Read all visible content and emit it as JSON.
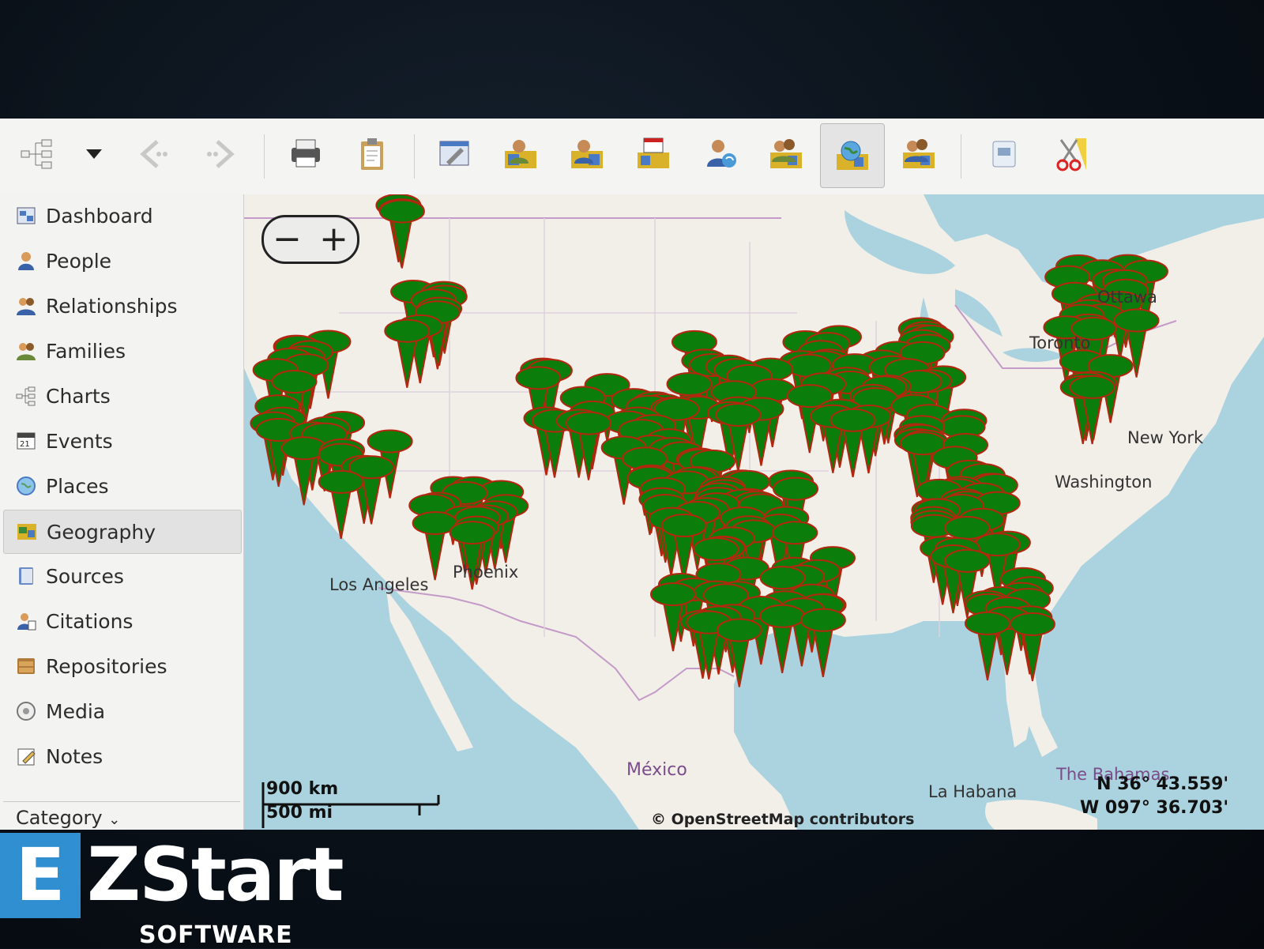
{
  "toolbar": {
    "buttons": [
      {
        "icon": "tree-chart-icon"
      },
      {
        "icon": "dropdown-arrow-icon"
      },
      {
        "icon": "back-arrow-icon"
      },
      {
        "icon": "forward-arrow-icon"
      },
      {
        "icon": "printer-icon"
      },
      {
        "icon": "clipboard-icon"
      },
      {
        "icon": "edit-settings-icon"
      },
      {
        "icon": "person-place-icon"
      },
      {
        "icon": "person-map-icon"
      },
      {
        "icon": "event-map-icon"
      },
      {
        "icon": "person-refresh-icon"
      },
      {
        "icon": "family-map-icon"
      },
      {
        "icon": "globe-map-icon"
      },
      {
        "icon": "family-places-icon"
      },
      {
        "icon": "sidebar-toggle-icon"
      },
      {
        "icon": "scissors-icon"
      }
    ]
  },
  "sidebar": {
    "items": [
      {
        "label": "Dashboard",
        "icon": "dashboard-icon"
      },
      {
        "label": "People",
        "icon": "person-icon"
      },
      {
        "label": "Relationships",
        "icon": "relationships-icon"
      },
      {
        "label": "Families",
        "icon": "families-icon"
      },
      {
        "label": "Charts",
        "icon": "charts-icon"
      },
      {
        "label": "Events",
        "icon": "calendar-icon"
      },
      {
        "label": "Places",
        "icon": "globe-icon"
      },
      {
        "label": "Geography",
        "icon": "geography-icon"
      },
      {
        "label": "Sources",
        "icon": "book-icon"
      },
      {
        "label": "Citations",
        "icon": "citation-icon"
      },
      {
        "label": "Repositories",
        "icon": "repository-icon"
      },
      {
        "label": "Media",
        "icon": "media-icon"
      },
      {
        "label": "Notes",
        "icon": "notes-icon"
      }
    ],
    "active": "Geography",
    "category_label": "Category"
  },
  "map": {
    "labels": {
      "ottawa": "Ottawa",
      "toronto": "Toronto",
      "new_york": "New York",
      "washington": "Washington",
      "los_angeles": "Los Angeles",
      "phoenix": "Phoenix",
      "mexico": "México",
      "la_habana": "La Habana",
      "bahamas": "The Bahamas"
    },
    "zoom_out": "−",
    "zoom_in": "+",
    "scale_km": "900 km",
    "scale_mi": "500 mi",
    "credit": "© OpenStreetMap contributors",
    "coord_lat": "N 36° 43.559'",
    "coord_lon": "W 097° 36.703'"
  },
  "colors": {
    "marker_fill": "#0a7d0a",
    "marker_stroke": "#b3260f",
    "land": "#f2efe9",
    "water": "#aad3df",
    "accent": "#2f8fd1"
  },
  "logo": {
    "letter": "E",
    "word": "ZStart",
    "sub": "SOFTWARE"
  }
}
